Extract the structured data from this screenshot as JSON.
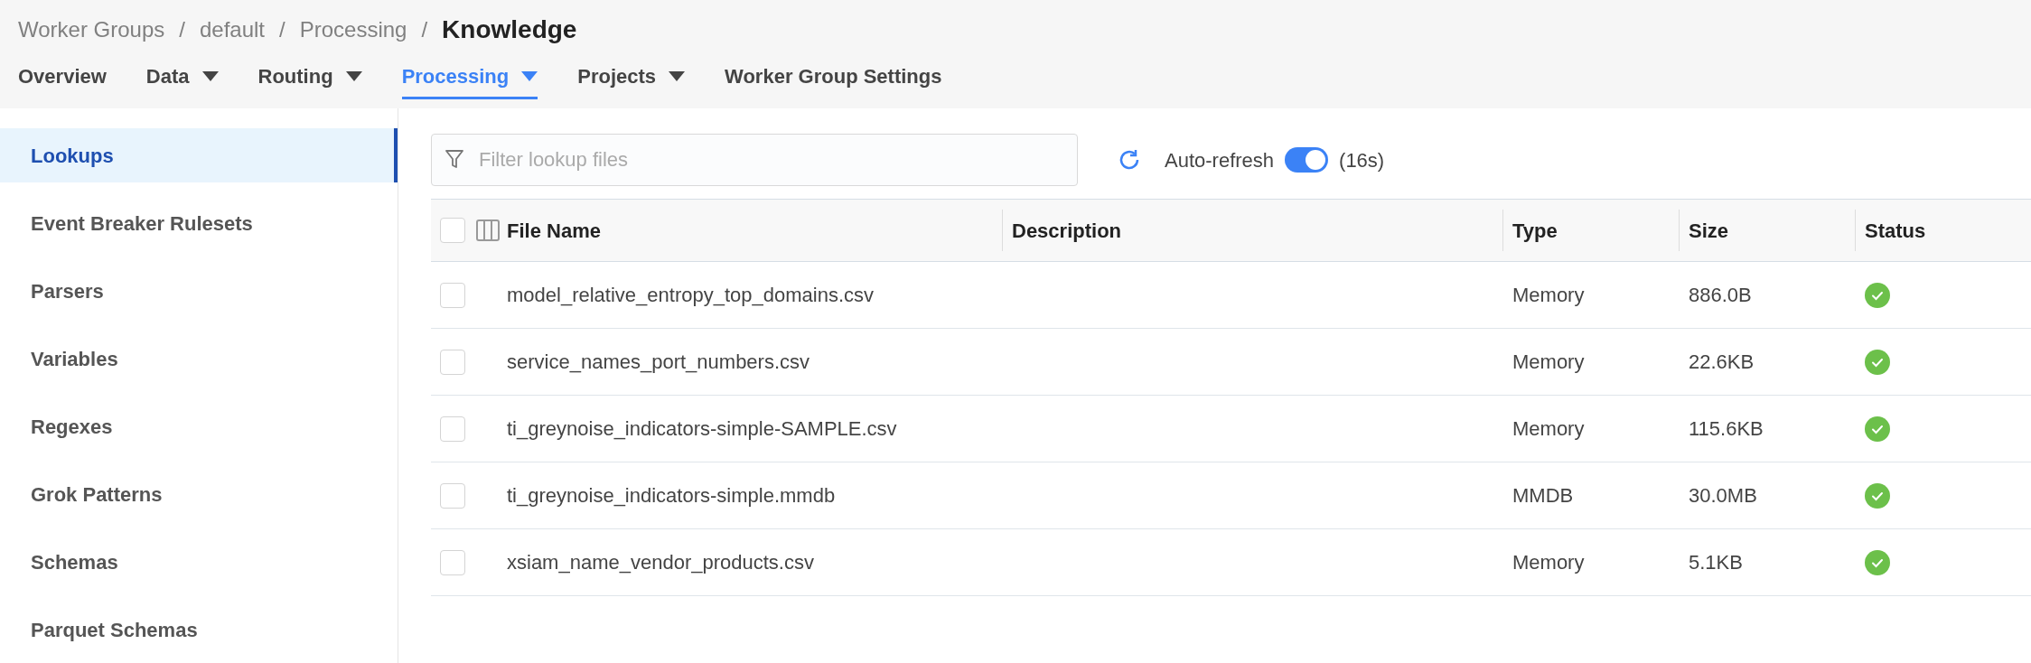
{
  "breadcrumb": [
    "Worker Groups",
    "default",
    "Processing"
  ],
  "breadcrumb_separator": "/",
  "page_title": "Knowledge",
  "tabs": [
    {
      "label": "Overview",
      "selected": false,
      "has_menu": false
    },
    {
      "label": "Data",
      "selected": false,
      "has_menu": true
    },
    {
      "label": "Routing",
      "selected": false,
      "has_menu": true
    },
    {
      "label": "Processing",
      "selected": true,
      "has_menu": true
    },
    {
      "label": "Projects",
      "selected": false,
      "has_menu": true
    },
    {
      "label": "Worker Group Settings",
      "selected": false,
      "has_menu": false
    }
  ],
  "sidebar": {
    "items": [
      {
        "label": "Lookups",
        "selected": true
      },
      {
        "label": "Event Breaker Rulesets",
        "selected": false
      },
      {
        "label": "Parsers",
        "selected": false
      },
      {
        "label": "Variables",
        "selected": false
      },
      {
        "label": "Regexes",
        "selected": false
      },
      {
        "label": "Grok Patterns",
        "selected": false
      },
      {
        "label": "Schemas",
        "selected": false
      },
      {
        "label": "Parquet Schemas",
        "selected": false
      }
    ]
  },
  "filter": {
    "placeholder": "Filter lookup files"
  },
  "auto_refresh": {
    "label": "Auto-refresh",
    "on": true,
    "countdown": "(16s)"
  },
  "table": {
    "select_all_checked": false,
    "columns": [
      "File Name",
      "Description",
      "Type",
      "Size",
      "Status"
    ],
    "rows": [
      {
        "checked": false,
        "file_name": "model_relative_entropy_top_domains.csv",
        "type": "Memory",
        "size": "886.0B",
        "ok": true
      },
      {
        "checked": false,
        "file_name": "service_names_port_numbers.csv",
        "type": "Memory",
        "size": "22.6KB",
        "ok": true
      },
      {
        "checked": false,
        "file_name": "ti_greynoise_indicators-simple-SAMPLE.csv",
        "type": "Memory",
        "size": "115.6KB",
        "ok": true
      },
      {
        "checked": false,
        "file_name": "ti_greynoise_indicators-simple.mmdb",
        "type": "MMDB",
        "size": "30.0MB",
        "ok": true
      },
      {
        "checked": false,
        "file_name": "xsiam_name_vendor_products.csv",
        "type": "Memory",
        "size": "5.1KB",
        "ok": true
      }
    ]
  }
}
